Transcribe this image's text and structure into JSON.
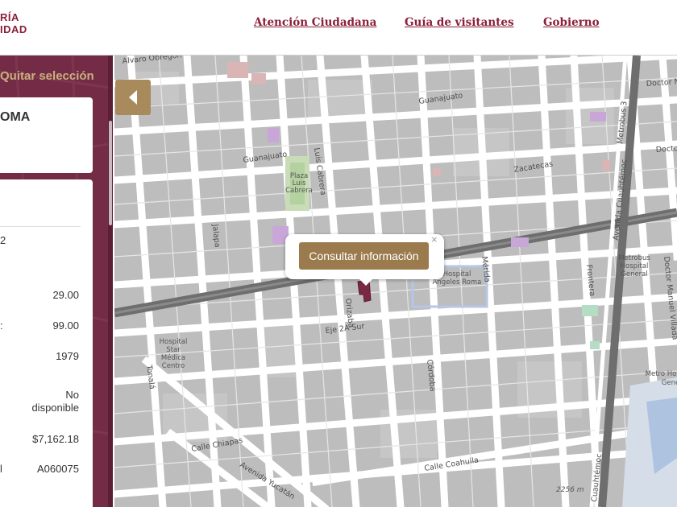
{
  "header": {
    "logo_line1": "RÍA",
    "logo_line2": "IDAD",
    "nav": [
      "Atención Ciudadana",
      "Guía de visitantes",
      "Gobierno"
    ]
  },
  "sidebar": {
    "quitar_label": "Quitar selección",
    "card_title": "OMA",
    "row0_label": "2",
    "rows": [
      {
        "label": "",
        "value": "29.00"
      },
      {
        "label": ":",
        "value": "99.00"
      },
      {
        "label": "",
        "value": "1979"
      },
      {
        "label": "",
        "value": "No disponible"
      },
      {
        "label": "",
        "value": "$7,162.18"
      },
      {
        "label": "l",
        "value": "A060075"
      }
    ]
  },
  "map": {
    "popup_button": "Consultar información",
    "close": "×",
    "scale": "2256 m",
    "streets": {
      "guanajuato_1": "Guanajuato",
      "guanajuato_2": "Guanajuato",
      "zacatecas": "Zacatecas",
      "luis_cabrera": "Luis Cabrera",
      "jalapa": "Jalapa",
      "orizaba": "Orizaba",
      "merida": "Mérida",
      "frontera": "Frontera",
      "eje2a": "Eje 2A Sur",
      "cordoba": "Córdoba",
      "tonala": "Tonalá",
      "chiapas": "Calle Chiapas",
      "yucatan": "Avenida Yucatán",
      "coahuila": "Calle Coahuila",
      "cuauhtemoc_1": "Avenida Cuauhtémoc",
      "cuauhtemoc_2": "Cuauhtémoc",
      "metrobus": "Metrobus 3",
      "manuel_villada": "Doctor Manuel Villada",
      "doctor_top": "Doctor N",
      "doctor_mid": "Docto",
      "obregon": "Alvaro Obregón"
    },
    "pois": {
      "plaza": [
        "Plaza",
        "Luis",
        "Cabrera"
      ],
      "hospital_roma": [
        "Hospital",
        "Ángeles Roma"
      ],
      "hospital_star": [
        "Hospital",
        "Star",
        "Médica",
        "Centro"
      ],
      "metrobus_hosp": [
        "Metrobus",
        "Hospital",
        "General"
      ],
      "metro_hosp": [
        "Metro Ho",
        "Gene"
      ]
    }
  }
}
